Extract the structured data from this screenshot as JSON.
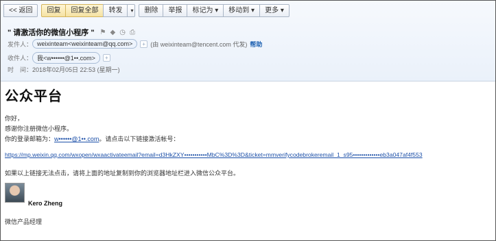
{
  "toolbar": {
    "back": "<< 返回",
    "reply": "回复",
    "reply_all": "回复全部",
    "forward": "转发",
    "dropdown": "▾",
    "delete": "删除",
    "report": "举报",
    "mark_as": "标记为 ▾",
    "move_to": "移动到 ▾",
    "more": "更多 ▾",
    "options": "▾"
  },
  "email": {
    "subject": "\" 请激活你的微信小程序 \"",
    "subject_icons": [
      "flag-icon",
      "tag-icon",
      "clock-icon",
      "print-icon"
    ],
    "from_label": "发件人：",
    "from_chip": "weixinteam<weixinteam@qq.com>",
    "proxy_text": "(由 weixinteam@tencent.com 代发)",
    "help": "帮助",
    "to_label": "收件人：",
    "to_chip": "我<w••••••@1••.com>",
    "time_label": "时　间：",
    "time_value": "2018年02月05日 22:53 (星期一)"
  },
  "content": {
    "heading": "公众平台",
    "greeting": "你好，",
    "thanks": "感谢你注册微信小程序。",
    "login_prefix": "你的登录邮箱为：",
    "login_email": "w••••••@1••.com",
    "login_suffix": "。请点击以下链接激活帐号：",
    "activation_link": "https://mp.weixin.qq.com/wxopen/wxaactivateemail?email=d3HkZXY•••••••••••MbC%3D%3D&ticket=mmverifycodebrokeremail_1_s95•••••••••••••eb3a047af4f553",
    "fallback": "如果以上链接无法点击，请将上面的地址复制到你的浏览器地址栏进入微信公众平台。",
    "signature_name": "Kero Zheng",
    "signature_title": "微信产品经理"
  }
}
